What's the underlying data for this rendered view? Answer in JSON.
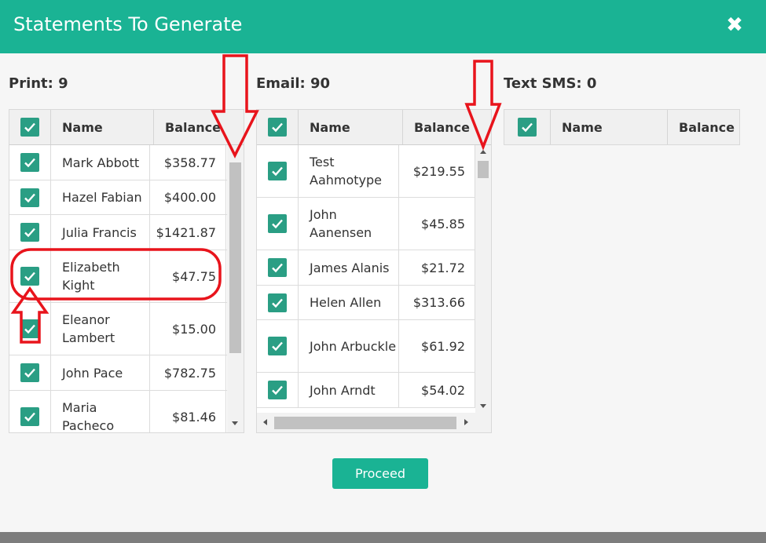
{
  "modal": {
    "title": "Statements To Generate",
    "close_icon": "times-icon"
  },
  "columns": {
    "print": {
      "label": "Print:",
      "count": "9",
      "headers": {
        "name": "Name",
        "balance": "Balance"
      },
      "rows": [
        {
          "name": "Mark Abbott",
          "balance": "$358.77"
        },
        {
          "name": "Hazel Fabian",
          "balance": "$400.00"
        },
        {
          "name": "Julia Francis",
          "balance": "$1421.87"
        },
        {
          "name": "Elizabeth Kight",
          "balance": "$47.75"
        },
        {
          "name": "Eleanor Lambert",
          "balance": "$15.00"
        },
        {
          "name": "John Pace",
          "balance": "$782.75"
        },
        {
          "name": "Maria Pacheco",
          "balance": "$81.46"
        }
      ]
    },
    "email": {
      "label": "Email:",
      "count": "90",
      "headers": {
        "name": "Name",
        "balance": "Balance"
      },
      "rows": [
        {
          "name": "Test Aahmotype",
          "balance": "$219.55"
        },
        {
          "name": "John Aanensen",
          "balance": "$45.85"
        },
        {
          "name": "James Alanis",
          "balance": "$21.72"
        },
        {
          "name": "Helen Allen",
          "balance": "$313.66"
        },
        {
          "name": "John Arbuckle",
          "balance": "$61.92"
        },
        {
          "name": "John Arndt",
          "balance": "$54.02"
        }
      ]
    },
    "sms": {
      "label": "Text SMS:",
      "count": "0",
      "headers": {
        "name": "Name",
        "balance": "Balance"
      },
      "rows": []
    }
  },
  "actions": {
    "proceed_label": "Proceed"
  },
  "colors": {
    "accent": "#1ab394",
    "checkbox": "#2a9e84",
    "annotation": "#e8141c"
  }
}
